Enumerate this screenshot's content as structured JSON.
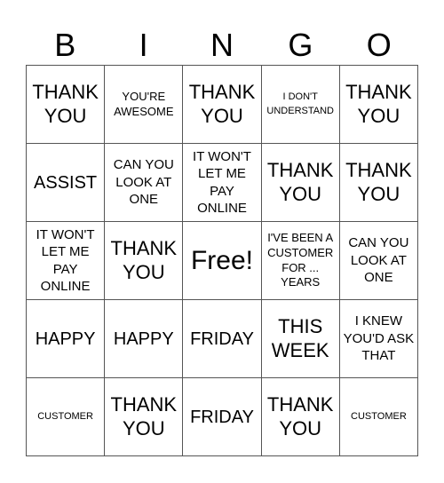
{
  "header": {
    "letters": [
      "B",
      "I",
      "N",
      "G",
      "O"
    ]
  },
  "cells": [
    {
      "text": "THANK YOU",
      "size": "l"
    },
    {
      "text": "YOU'RE AWESOME",
      "size": "xs"
    },
    {
      "text": "THANK YOU",
      "size": "l"
    },
    {
      "text": "I DON'T UNDERSTAND",
      "size": "xxs"
    },
    {
      "text": "THANK YOU",
      "size": "l"
    },
    {
      "text": "ASSIST",
      "size": "m"
    },
    {
      "text": "CAN YOU LOOK AT ONE",
      "size": "s"
    },
    {
      "text": "IT WON'T LET ME PAY ONLINE",
      "size": "s"
    },
    {
      "text": "THANK YOU",
      "size": "l"
    },
    {
      "text": "THANK YOU",
      "size": "l"
    },
    {
      "text": "IT WON'T LET ME PAY ONLINE",
      "size": "s"
    },
    {
      "text": "THANK YOU",
      "size": "l"
    },
    {
      "text": "Free!",
      "size": "xl"
    },
    {
      "text": "I'VE BEEN A CUSTOMER FOR ... YEARS",
      "size": "xs"
    },
    {
      "text": "CAN YOU LOOK AT ONE",
      "size": "s"
    },
    {
      "text": "HAPPY",
      "size": "m"
    },
    {
      "text": "HAPPY",
      "size": "m"
    },
    {
      "text": "FRIDAY",
      "size": "m"
    },
    {
      "text": "THIS WEEK",
      "size": "l"
    },
    {
      "text": "I KNEW YOU'D ASK THAT",
      "size": "s"
    },
    {
      "text": "CUSTOMER",
      "size": "xxs"
    },
    {
      "text": "THANK YOU",
      "size": "l"
    },
    {
      "text": "FRIDAY",
      "size": "m"
    },
    {
      "text": "THANK YOU",
      "size": "l"
    },
    {
      "text": "CUSTOMER",
      "size": "xxs"
    }
  ]
}
